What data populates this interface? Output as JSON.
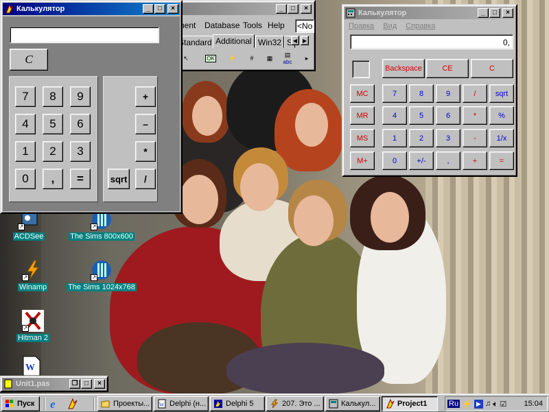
{
  "calc1": {
    "title": "Калькулятор",
    "display_value": "",
    "clear_label": "C",
    "digits": [
      "7",
      "8",
      "9",
      "4",
      "5",
      "6",
      "1",
      "2",
      "3",
      "0",
      ",",
      "="
    ],
    "ops": [
      "+",
      "–",
      "*",
      "sqrt",
      "/"
    ]
  },
  "delphi": {
    "menu": [
      "nent",
      "Database",
      "Tools",
      "Help"
    ],
    "combo_text": "<No",
    "tabs": [
      "Standard",
      "Additional",
      "Win32",
      "S"
    ],
    "tool_labels": [
      "OK",
      "abc"
    ]
  },
  "calc2": {
    "title": "Калькулятор",
    "menu": [
      "Правка",
      "Вид",
      "Справка"
    ],
    "display_value": "0,",
    "top_buttons": [
      "Backspace",
      "CE",
      "C"
    ],
    "memory": [
      "MC",
      "MR",
      "MS",
      "M+"
    ],
    "rows": [
      [
        "7",
        "8",
        "9",
        "/",
        "sqrt"
      ],
      [
        "4",
        "5",
        "6",
        "*",
        "%"
      ],
      [
        "1",
        "2",
        "3",
        "-",
        "1/x"
      ],
      [
        "0",
        "+/-",
        ",",
        "+",
        "="
      ]
    ]
  },
  "desktop_icons": [
    {
      "label": "ACDSee",
      "icon": "acdsee-icon"
    },
    {
      "label": "The Sims 800x600",
      "icon": "sims-icon"
    },
    {
      "label": "Winamp",
      "icon": "winamp-icon"
    },
    {
      "label": "The Sims 1024x768",
      "icon": "sims-icon"
    },
    {
      "label": "Hitman 2",
      "icon": "hitman-icon"
    },
    {
      "label": "",
      "icon": "word-document-icon"
    }
  ],
  "unit_window": {
    "title": "Unit1.pas"
  },
  "taskbar": {
    "start_label": "Пуск",
    "items": [
      "Проекты...",
      "Delphi (н...",
      "Delphi 5",
      "207. Это ...",
      "Калькул...",
      "Project1"
    ],
    "language": "Ru",
    "clock": "15:04"
  },
  "colors": {
    "titlebar_active": "#000080",
    "desktop_label_bg": "#008080",
    "calc_digit": "#0000d0",
    "calc_op": "#d00000"
  }
}
